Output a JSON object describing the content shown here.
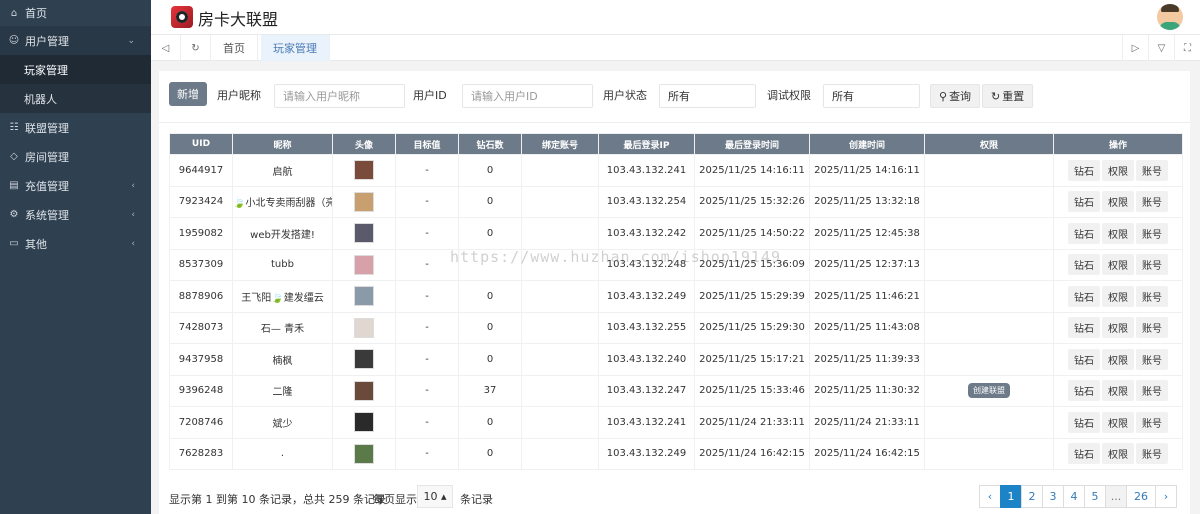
{
  "sidebar": {
    "home": {
      "icon": "home-icon",
      "label": "首页"
    },
    "user_mgmt": {
      "icon": "user-icon",
      "label": "用户管理"
    },
    "sub_items": [
      {
        "label": "玩家管理"
      },
      {
        "label": "机器人"
      }
    ],
    "items": [
      {
        "icon": "users-icon",
        "label": "联盟管理"
      },
      {
        "icon": "diamond-icon",
        "label": "房间管理"
      },
      {
        "icon": "card-icon",
        "label": "充值管理"
      },
      {
        "icon": "gear-icon",
        "label": "系统管理"
      },
      {
        "icon": "folder-icon",
        "label": "其他"
      }
    ]
  },
  "header": {
    "brand": "房卡大联盟"
  },
  "tabs": [
    {
      "label": "首页"
    },
    {
      "label": "玩家管理"
    }
  ],
  "filters": {
    "new_button": "新增",
    "nickname_label": "用户昵称",
    "nickname_placeholder": "请输入用户昵称",
    "userid_label": "用户ID",
    "userid_placeholder": "请输入用户ID",
    "status_label": "用户状态",
    "status_value": "所有",
    "debug_label": "调试权限",
    "debug_value": "所有",
    "search_button": "查询",
    "reset_button": "重置"
  },
  "table": {
    "columns": [
      "UID",
      "昵称",
      "头像",
      "目标值",
      "钻石数",
      "绑定账号",
      "最后登录IP",
      "最后登录时间",
      "创建时间",
      "权限",
      "操作"
    ],
    "actions": [
      "钻石",
      "权限",
      "账号"
    ],
    "rows": [
      {
        "uid": "9644917",
        "nickname": "启航",
        "avatar_color": "#7a4a3a",
        "target": "-",
        "diamonds": "0",
        "bound": "",
        "ip": "103.43.132.241",
        "last_login": "2025/11/25 14:16:11",
        "created": "2025/11/25 14:16:11",
        "perm": ""
      },
      {
        "uid": "7923424",
        "nickname": "🍃小北专卖雨刮器（亮",
        "avatar_color": "#c8a070",
        "target": "-",
        "diamonds": "0",
        "bound": "",
        "ip": "103.43.132.254",
        "last_login": "2025/11/25 15:32:26",
        "created": "2025/11/25 13:32:18",
        "perm": ""
      },
      {
        "uid": "1959082",
        "nickname": "web开发搭建!",
        "avatar_color": "#5a5a6a",
        "target": "-",
        "diamonds": "0",
        "bound": "",
        "ip": "103.43.132.242",
        "last_login": "2025/11/25 14:50:22",
        "created": "2025/11/25 12:45:38",
        "perm": ""
      },
      {
        "uid": "8537309",
        "nickname": "tubb",
        "avatar_color": "#d8a0a8",
        "target": "-",
        "diamonds": "",
        "bound": "",
        "ip": "103.43.132.248",
        "last_login": "2025/11/25 15:36:09",
        "created": "2025/11/25 12:37:13",
        "perm": ""
      },
      {
        "uid": "8878906",
        "nickname": "王飞阳🍃建发缰云",
        "avatar_color": "#8a9aa8",
        "target": "-",
        "diamonds": "0",
        "bound": "",
        "ip": "103.43.132.249",
        "last_login": "2025/11/25 15:29:39",
        "created": "2025/11/25 11:46:21",
        "perm": ""
      },
      {
        "uid": "7428073",
        "nickname": "石— 青禾",
        "avatar_color": "#e0d8d0",
        "target": "-",
        "diamonds": "0",
        "bound": "",
        "ip": "103.43.132.255",
        "last_login": "2025/11/25 15:29:30",
        "created": "2025/11/25 11:43:08",
        "perm": ""
      },
      {
        "uid": "9437958",
        "nickname": "楠枫",
        "avatar_color": "#3a3a3a",
        "target": "-",
        "diamonds": "0",
        "bound": "",
        "ip": "103.43.132.240",
        "last_login": "2025/11/25 15:17:21",
        "created": "2025/11/25 11:39:33",
        "perm": ""
      },
      {
        "uid": "9396248",
        "nickname": "二隆",
        "avatar_color": "#6a4a3a",
        "target": "-",
        "diamonds": "37",
        "bound": "",
        "ip": "103.43.132.247",
        "last_login": "2025/11/25 15:33:46",
        "created": "2025/11/25 11:30:32",
        "perm": "创建联盟"
      },
      {
        "uid": "7208746",
        "nickname": "斌少",
        "avatar_color": "#2a2a2a",
        "target": "-",
        "diamonds": "0",
        "bound": "",
        "ip": "103.43.132.241",
        "last_login": "2025/11/24 21:33:11",
        "created": "2025/11/24 21:33:11",
        "perm": ""
      },
      {
        "uid": "7628283",
        "nickname": ".",
        "avatar_color": "#5a7a4a",
        "target": "-",
        "diamonds": "0",
        "bound": "",
        "ip": "103.43.132.249",
        "last_login": "2025/11/24 16:42:15",
        "created": "2025/11/24 16:42:15",
        "perm": ""
      }
    ]
  },
  "footer": {
    "summary": "显示第 1 到第 10 条记录，总共 259 条记录",
    "per_page_prefix": "每页显示",
    "page_size": "10 ▴",
    "per_page_suffix": "条记录",
    "pages": [
      "‹",
      "1",
      "2",
      "3",
      "4",
      "5",
      "...",
      "26",
      "›"
    ],
    "current_page": "1"
  },
  "watermark": "https://www.huzhan.com/ishop19149"
}
